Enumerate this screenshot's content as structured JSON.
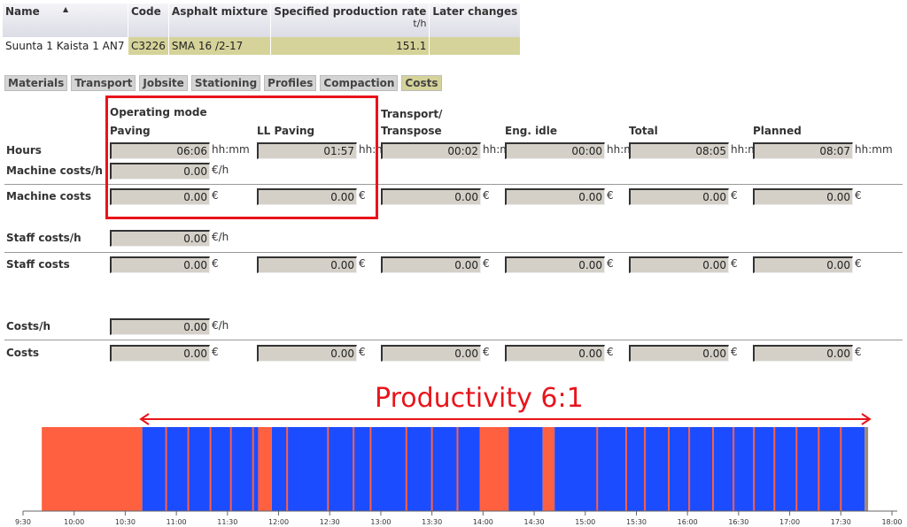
{
  "table": {
    "columns": [
      "Name",
      "Code",
      "Asphalt mixture",
      "Specified production rate",
      "Later changes"
    ],
    "rate_unit": "t/h",
    "row": {
      "name": "Suunta 1 Kaista 1 AN7",
      "code": "C3226",
      "mixture": "SMA 16 /2-17",
      "rate": "151.1",
      "later": ""
    }
  },
  "tabs": [
    {
      "label": "Materials"
    },
    {
      "label": "Transport"
    },
    {
      "label": "Jobsite"
    },
    {
      "label": "Stationing"
    },
    {
      "label": "Profiles"
    },
    {
      "label": "Compaction"
    },
    {
      "label": "Costs",
      "active": true
    }
  ],
  "costs": {
    "group_header": "Operating mode",
    "columns": [
      "Paving",
      "LL Paving",
      "Transport/\nTranspose",
      "Eng. idle",
      "Total",
      "Planned"
    ],
    "rows": {
      "hours": {
        "label": "Hours",
        "unit": "hh:mm",
        "values": [
          "06:06",
          "01:57",
          "00:02",
          "00:00",
          "08:05",
          "08:07"
        ]
      },
      "machine_rate": {
        "label": "Machine costs/h",
        "unit": "€/h",
        "value": "0.00"
      },
      "machine_costs": {
        "label": "Machine costs",
        "unit": "€",
        "values": [
          "0.00",
          "0.00",
          "0.00",
          "0.00",
          "0.00",
          "0.00"
        ]
      },
      "staff_rate": {
        "label": "Staff costs/h",
        "unit": "€/h",
        "value": "0.00"
      },
      "staff_costs": {
        "label": "Staff costs",
        "unit": "€",
        "values": [
          "0.00",
          "0.00",
          "0.00",
          "0.00",
          "0.00",
          "0.00"
        ]
      },
      "cost_rate": {
        "label": "Costs/h",
        "unit": "€/h",
        "value": "0.00"
      },
      "costs": {
        "label": "Costs",
        "unit": "€",
        "values": [
          "0.00",
          "0.00",
          "0.00",
          "0.00",
          "0.00",
          "0.00"
        ]
      }
    }
  },
  "annotation": {
    "text": "Productivity 6:1",
    "color": "#e8141b"
  },
  "timeline": {
    "colors": {
      "paving": "#1c4cff",
      "idle": "#ff6040",
      "end": "#a08878"
    },
    "axis_ticks": [
      "9:30",
      "10:00",
      "10:30",
      "11:00",
      "11:30",
      "12:00",
      "12:30",
      "13:00",
      "13:30",
      "14:00",
      "14:30",
      "15:00",
      "15:30",
      "16:00",
      "16:30",
      "17:00",
      "17:30",
      "18:00"
    ],
    "segments": [
      {
        "start": "9:41",
        "end": "10:40",
        "state": "idle"
      },
      {
        "start": "10:40",
        "end": "11:48",
        "state": "paving"
      },
      {
        "start": "11:48",
        "end": "11:56",
        "state": "idle"
      },
      {
        "start": "11:56",
        "end": "13:58",
        "state": "paving"
      },
      {
        "start": "13:58",
        "end": "14:15",
        "state": "idle"
      },
      {
        "start": "14:15",
        "end": "14:35",
        "state": "paving"
      },
      {
        "start": "14:35",
        "end": "14:42",
        "state": "idle"
      },
      {
        "start": "14:42",
        "end": "17:44",
        "state": "paving"
      },
      {
        "start": "17:44",
        "end": "17:46",
        "state": "end"
      }
    ],
    "short_stops": [
      "10:54",
      "11:07",
      "11:20",
      "11:32",
      "11:45",
      "12:05",
      "12:29",
      "12:44",
      "12:54",
      "13:15",
      "13:30",
      "13:45",
      "15:07",
      "15:24",
      "15:35",
      "15:49",
      "16:01",
      "16:15",
      "16:27",
      "16:39",
      "16:51",
      "17:04",
      "17:17",
      "17:30"
    ]
  }
}
